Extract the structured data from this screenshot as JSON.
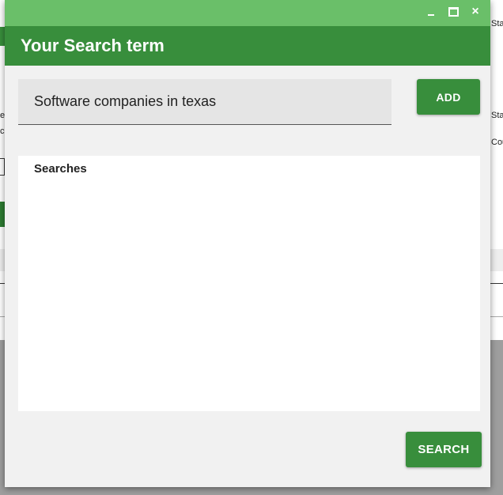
{
  "window": {
    "minimize_glyph": "_",
    "maximize_glyph": "□",
    "close_glyph": "×"
  },
  "dialog": {
    "title": "Your Search term"
  },
  "search_input": {
    "value": "Software companies in texas",
    "placeholder": ""
  },
  "buttons": {
    "add_label": "ADD",
    "search_label": "SEARCH"
  },
  "searches": {
    "label": "Searches",
    "items": []
  },
  "background": {
    "right_text_1": "Stat",
    "right_text_2": "Stat",
    "right_text_3": "Cou",
    "left_text_1": "e",
    "left_text_2": "c"
  },
  "colors": {
    "titlebar": "#6abf69",
    "header": "#388e3c",
    "button": "#388e3c",
    "dialog_bg": "#f1f1f1",
    "input_bg": "#e5e5e5"
  }
}
